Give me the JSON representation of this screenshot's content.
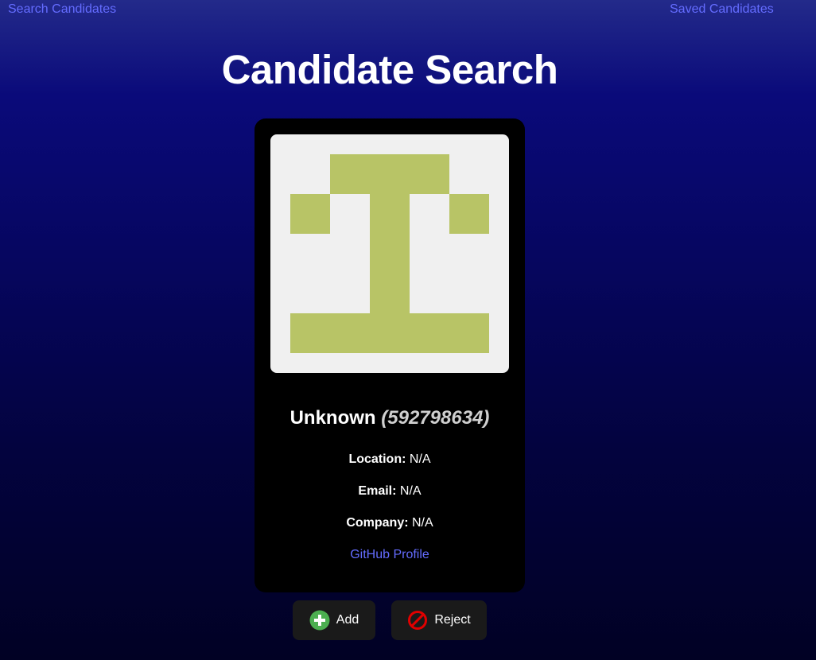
{
  "nav": {
    "search_label": "Search Candidates",
    "saved_label": "Saved Candidates"
  },
  "page": {
    "title": "Candidate Search"
  },
  "candidate": {
    "name": "Unknown",
    "login_display": "(592798634)",
    "location_label": "Location:",
    "location_value": "N/A",
    "email_label": "Email:",
    "email_value": "N/A",
    "company_label": "Company:",
    "company_value": "N/A",
    "profile_link_label": "GitHub Profile",
    "avatar_color": "#b8c466",
    "avatar_background": "#f0f0f0"
  },
  "actions": {
    "add_label": "Add",
    "add_icon": "plus-circle-icon",
    "add_icon_color": "#4caf50",
    "reject_label": "Reject",
    "reject_icon": "no-entry-icon",
    "reject_icon_color": "#e00000"
  },
  "colors": {
    "link": "#646cff",
    "card_bg": "#000000",
    "button_bg": "#1a1a1a"
  }
}
